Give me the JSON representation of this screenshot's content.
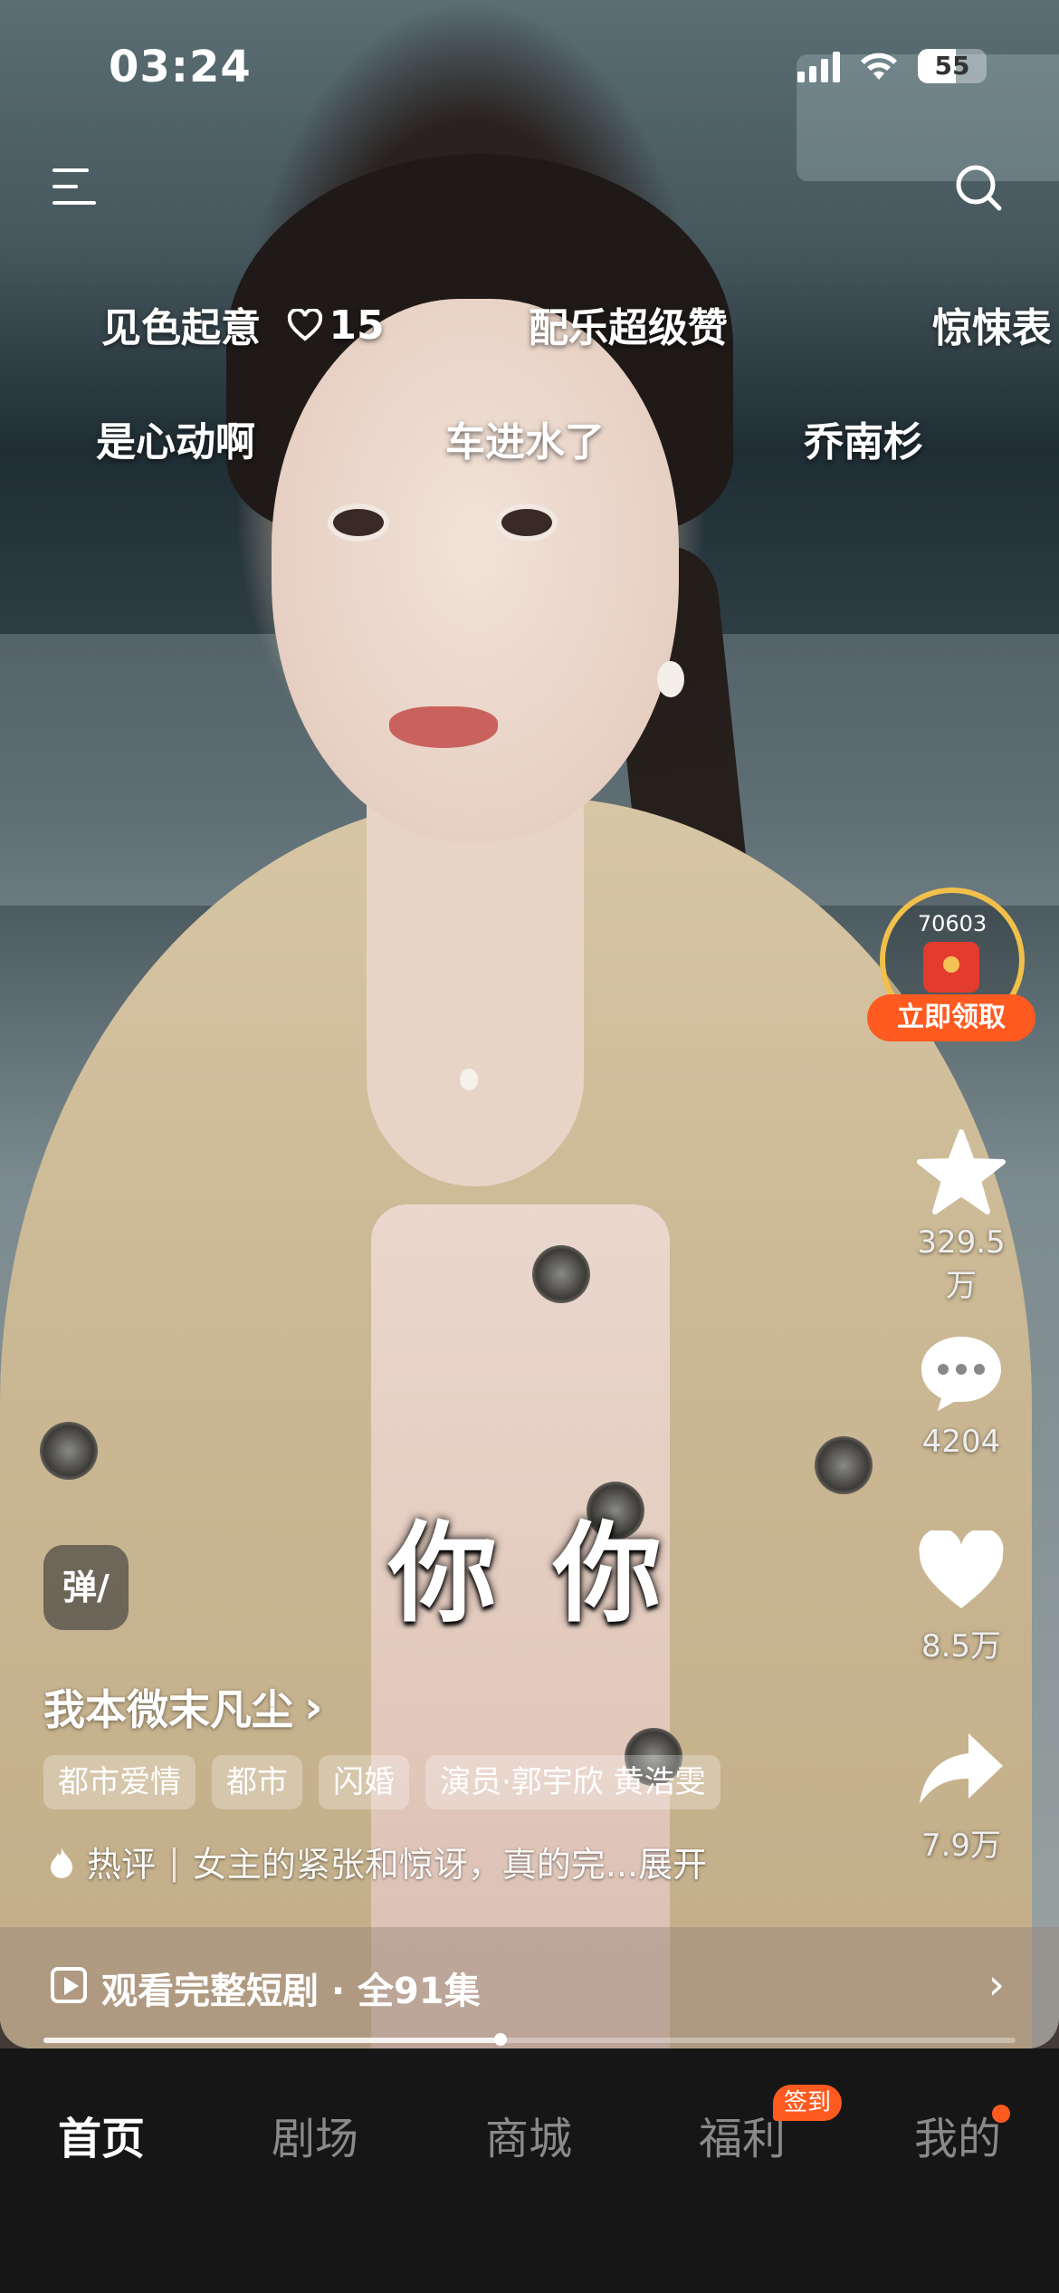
{
  "status_bar": {
    "time": "03:24",
    "battery": "55"
  },
  "floating_tags": {
    "row1": [
      "见色起意",
      "配乐超级赞",
      "惊悚表"
    ],
    "row1_like_count": "15",
    "row2": [
      "是心动啊",
      "车进水了",
      "乔南杉"
    ]
  },
  "reward": {
    "amount": "70603",
    "cta": "立即领取"
  },
  "actions": {
    "favorite_count": "329.5万",
    "comment_count": "4204",
    "like_count": "8.5万",
    "share_count": "7.9万"
  },
  "subtitle": "你 你",
  "danmaku_label": "弹/",
  "author": {
    "name": "我本微末凡尘",
    "chevron": "›"
  },
  "genre_tags": [
    "都市爱情",
    "都市",
    "闪婚",
    "演员·郭宇欣 黄浩雯"
  ],
  "hot_comment": {
    "label": "热评",
    "separator": "|",
    "text": "女主的紧张和惊讶，真的完...",
    "expand": "展开"
  },
  "watch_full": {
    "label": "观看完整短剧 · 全91集",
    "chevron": "›"
  },
  "playback": {
    "progress": 0.47
  },
  "tabs": [
    {
      "label": "首页",
      "active": true
    },
    {
      "label": "剧场"
    },
    {
      "label": "商城"
    },
    {
      "label": "福利",
      "badge": "签到"
    },
    {
      "label": "我的",
      "dot": true
    }
  ],
  "colors": {
    "accent": "#ff5a1f",
    "gold": "#f2c04a",
    "tabbar": "#161616"
  }
}
